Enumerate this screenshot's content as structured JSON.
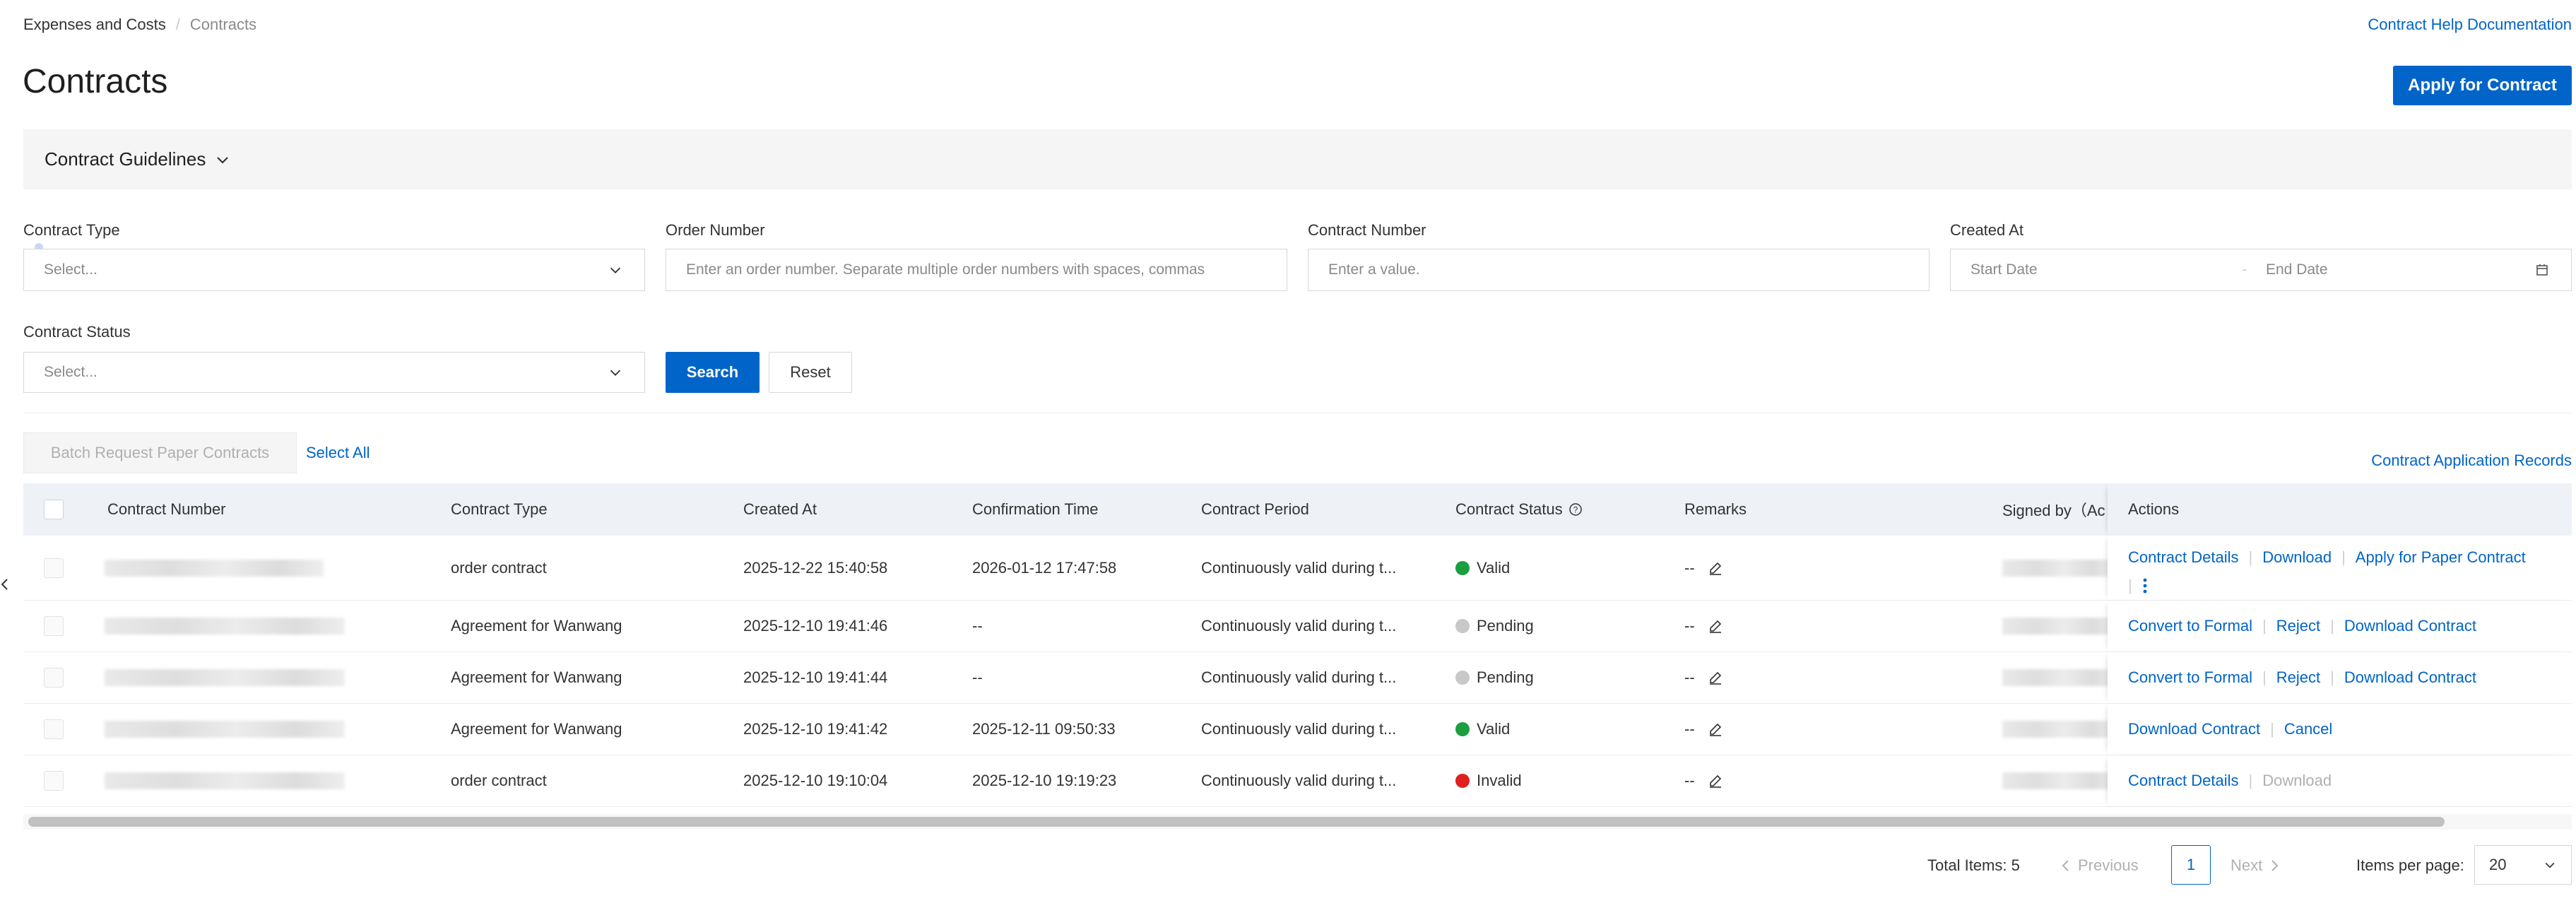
{
  "breadcrumb": {
    "home": "Expenses and Costs",
    "current": "Contracts"
  },
  "help_link": "Contract Help Documentation",
  "page_title": "Contracts",
  "apply_button": "Apply for Contract",
  "guidelines_label": "Contract Guidelines",
  "filters": {
    "contract_type": {
      "label": "Contract Type",
      "placeholder": "Select..."
    },
    "order_number": {
      "label": "Order Number",
      "placeholder": "Enter an order number. Separate multiple order numbers with spaces, commas"
    },
    "contract_number": {
      "label": "Contract Number",
      "placeholder": "Enter a value."
    },
    "created_at": {
      "label": "Created At",
      "start_placeholder": "Start Date",
      "end_placeholder": "End Date"
    },
    "contract_status": {
      "label": "Contract Status",
      "placeholder": "Select..."
    },
    "search_label": "Search",
    "reset_label": "Reset"
  },
  "toolbar": {
    "batch_label": "Batch Request Paper Contracts",
    "select_all_label": "Select All",
    "records_link": "Contract Application Records"
  },
  "table": {
    "headers": {
      "number": "Contract Number",
      "type": "Contract Type",
      "created": "Created At",
      "confirmation": "Confirmation Time",
      "period": "Contract Period",
      "status": "Contract Status",
      "remarks": "Remarks",
      "signed": "Signed by（Ac",
      "actions": "Actions"
    },
    "rows": [
      {
        "type": "order contract",
        "created": "2025-12-22 15:40:58",
        "confirmation": "2026-01-12 17:47:58",
        "period": "Continuously valid during t...",
        "status": "Valid",
        "status_color": "#1a9e3f",
        "remarks": "--",
        "actions": [
          "Contract Details",
          "Download",
          "Apply for Paper Contract"
        ]
      },
      {
        "type": "Agreement for Wanwang",
        "created": "2025-12-10 19:41:46",
        "confirmation": "--",
        "period": "Continuously valid during t...",
        "status": "Pending",
        "status_color": "#c8c8c8",
        "remarks": "--",
        "actions": [
          "Convert to Formal",
          "Reject",
          "Download Contract"
        ]
      },
      {
        "type": "Agreement for Wanwang",
        "created": "2025-12-10 19:41:44",
        "confirmation": "--",
        "period": "Continuously valid during t...",
        "status": "Pending",
        "status_color": "#c8c8c8",
        "remarks": "--",
        "actions": [
          "Convert to Formal",
          "Reject",
          "Download Contract"
        ]
      },
      {
        "type": "Agreement for Wanwang",
        "created": "2025-12-10 19:41:42",
        "confirmation": "2025-12-11 09:50:33",
        "period": "Continuously valid during t...",
        "status": "Valid",
        "status_color": "#1a9e3f",
        "remarks": "--",
        "actions": [
          "Download Contract",
          "Cancel"
        ]
      },
      {
        "type": "order contract",
        "created": "2025-12-10 19:10:04",
        "confirmation": "2025-12-10 19:19:23",
        "period": "Continuously valid during t...",
        "status": "Invalid",
        "status_color": "#e02020",
        "remarks": "--",
        "actions": [
          "Contract Details",
          "Download"
        ]
      }
    ]
  },
  "pagination": {
    "total": "Total Items: 5",
    "previous": "Previous",
    "current_page": "1",
    "next": "Next",
    "items_per_page_label": "Items per page:",
    "page_size": "20"
  },
  "colors": {
    "accent": "#0064c8",
    "header_bg": "#eef1f6"
  }
}
